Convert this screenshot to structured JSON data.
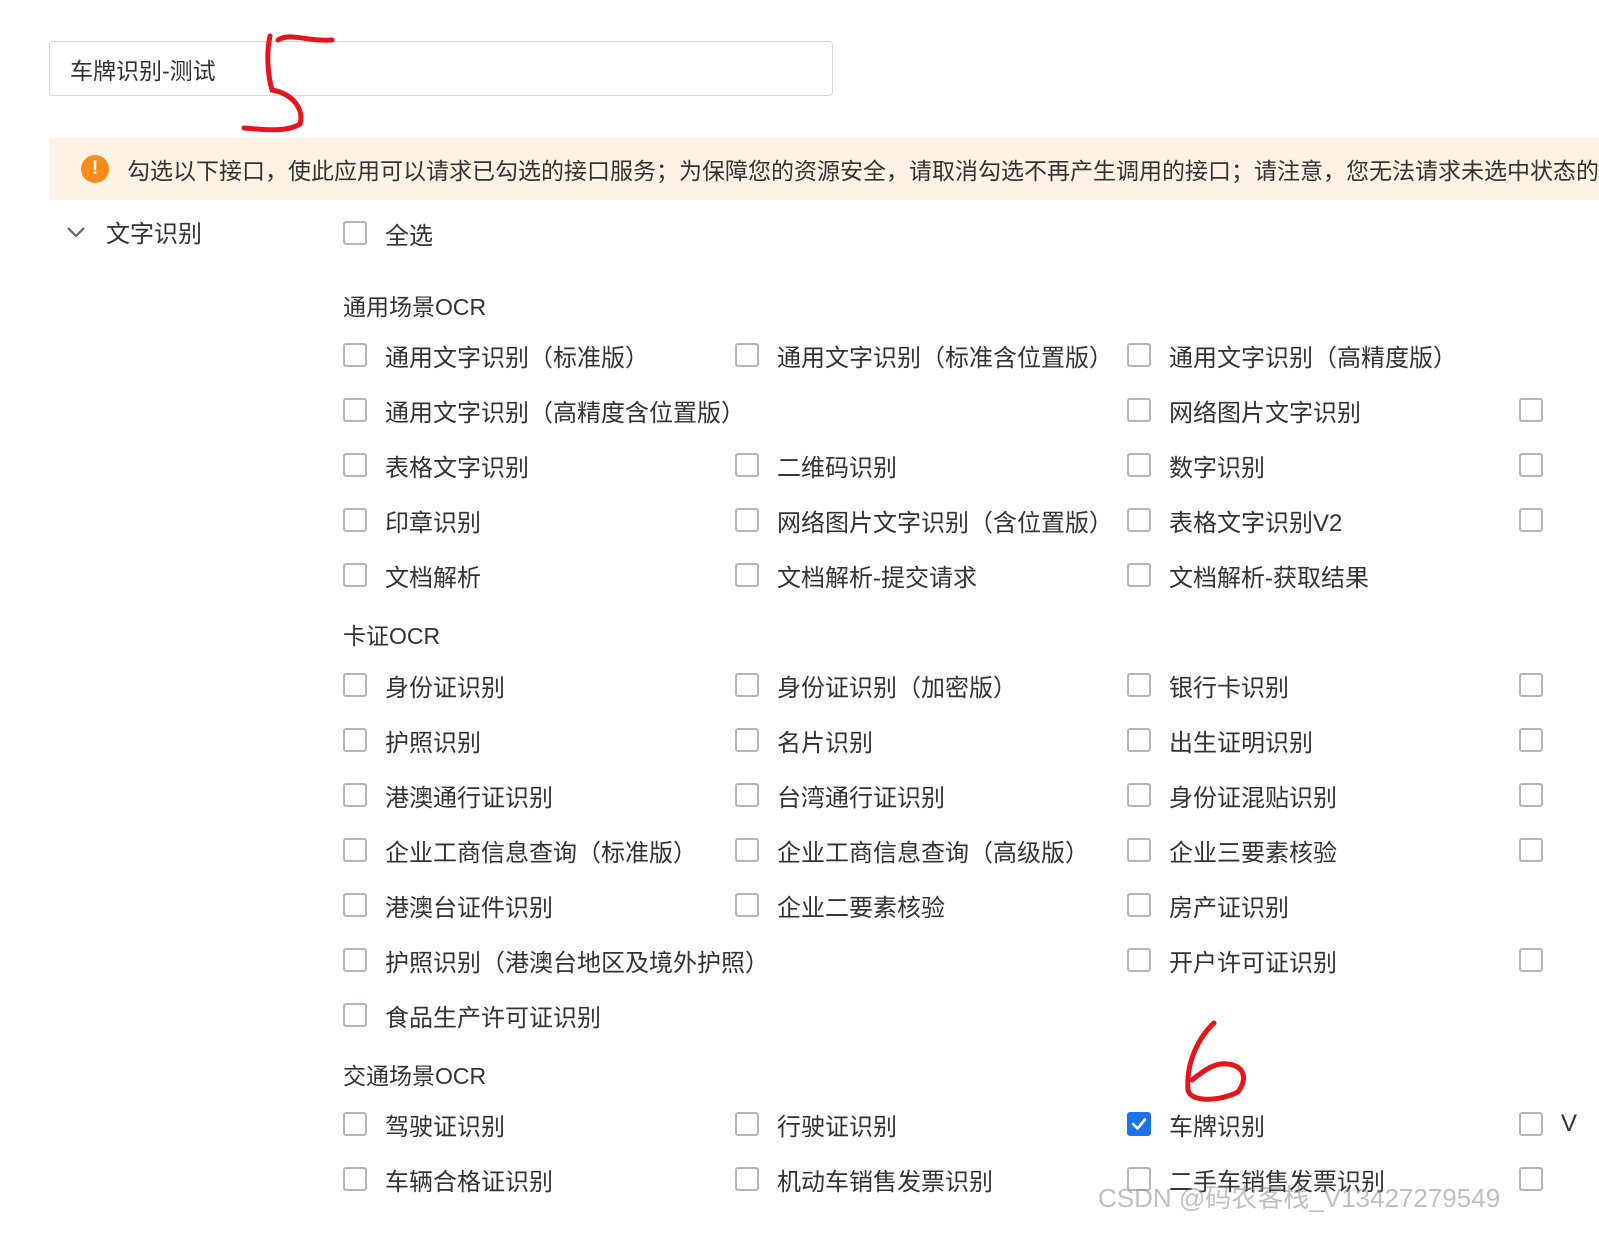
{
  "app_name_input": {
    "value": "车牌识别-测试"
  },
  "notice": {
    "text": "勾选以下接口，使此应用可以请求已勾选的接口服务；为保障您的资源安全，请取消勾选不再产生调用的接口；请注意，您无法请求未选中状态的接口",
    "icon": "exclamation-icon"
  },
  "category": {
    "label": "文字识别",
    "icon": "chevron-down-icon"
  },
  "select_all": {
    "label": "全选",
    "checked": false
  },
  "groups": {
    "general": {
      "title": "通用场景OCR",
      "items": [
        {
          "label": "通用文字识别（标准版）",
          "checked": false
        },
        {
          "label": "通用文字识别（标准含位置版）",
          "checked": false
        },
        {
          "label": "通用文字识别（高精度版）",
          "checked": false
        },
        {
          "label": "通用文字识别（高精度含位置版）",
          "checked": false
        },
        {
          "label": "网络图片文字识别",
          "checked": false
        },
        {
          "label": "",
          "checked": false
        },
        {
          "label": "表格文字识别",
          "checked": false
        },
        {
          "label": "二维码识别",
          "checked": false
        },
        {
          "label": "数字识别",
          "checked": false
        },
        {
          "label": "",
          "checked": false
        },
        {
          "label": "印章识别",
          "checked": false
        },
        {
          "label": "网络图片文字识别（含位置版）",
          "checked": false
        },
        {
          "label": "表格文字识别V2",
          "checked": false
        },
        {
          "label": "",
          "checked": false
        },
        {
          "label": "文档解析",
          "checked": false
        },
        {
          "label": "文档解析-提交请求",
          "checked": false
        },
        {
          "label": "文档解析-获取结果",
          "checked": false
        }
      ]
    },
    "card": {
      "title": "卡证OCR",
      "items": [
        {
          "label": "身份证识别",
          "checked": false
        },
        {
          "label": "身份证识别（加密版）",
          "checked": false
        },
        {
          "label": "银行卡识别",
          "checked": false
        },
        {
          "label": "",
          "checked": false
        },
        {
          "label": "护照识别",
          "checked": false
        },
        {
          "label": "名片识别",
          "checked": false
        },
        {
          "label": "出生证明识别",
          "checked": false
        },
        {
          "label": "",
          "checked": false
        },
        {
          "label": "港澳通行证识别",
          "checked": false
        },
        {
          "label": "台湾通行证识别",
          "checked": false
        },
        {
          "label": "身份证混贴识别",
          "checked": false
        },
        {
          "label": "",
          "checked": false
        },
        {
          "label": "企业工商信息查询（标准版）",
          "checked": false
        },
        {
          "label": "企业工商信息查询（高级版）",
          "checked": false
        },
        {
          "label": "企业三要素核验",
          "checked": false
        },
        {
          "label": "",
          "checked": false
        },
        {
          "label": "港澳台证件识别",
          "checked": false
        },
        {
          "label": "企业二要素核验",
          "checked": false
        },
        {
          "label": "房产证识别",
          "checked": false
        },
        {
          "label": "护照识别（港澳台地区及境外护照）",
          "checked": false
        },
        {
          "label": "开户许可证识别",
          "checked": false
        },
        {
          "label": "",
          "checked": false
        },
        {
          "label": "食品生产许可证识别",
          "checked": false
        }
      ]
    },
    "traffic": {
      "title": "交通场景OCR",
      "items": [
        {
          "label": "驾驶证识别",
          "checked": false
        },
        {
          "label": "行驶证识别",
          "checked": false
        },
        {
          "label": "车牌识别",
          "checked": true
        },
        {
          "label": "V",
          "checked": false
        },
        {
          "label": "车辆合格证识别",
          "checked": false
        },
        {
          "label": "机动车销售发票识别",
          "checked": false
        },
        {
          "label": "二手车销售发票识别",
          "checked": false
        },
        {
          "label": "",
          "checked": false
        }
      ]
    }
  },
  "annotations": {
    "five": "5",
    "six": "6"
  },
  "watermark": {
    "text": "CSDN @码农客栈_V13427279549"
  },
  "colors": {
    "checkbox_checked": "#1a73e8",
    "warning": "#ff8b1a",
    "notice_bg": "#fff3e6",
    "annotation": "#e8141c"
  }
}
